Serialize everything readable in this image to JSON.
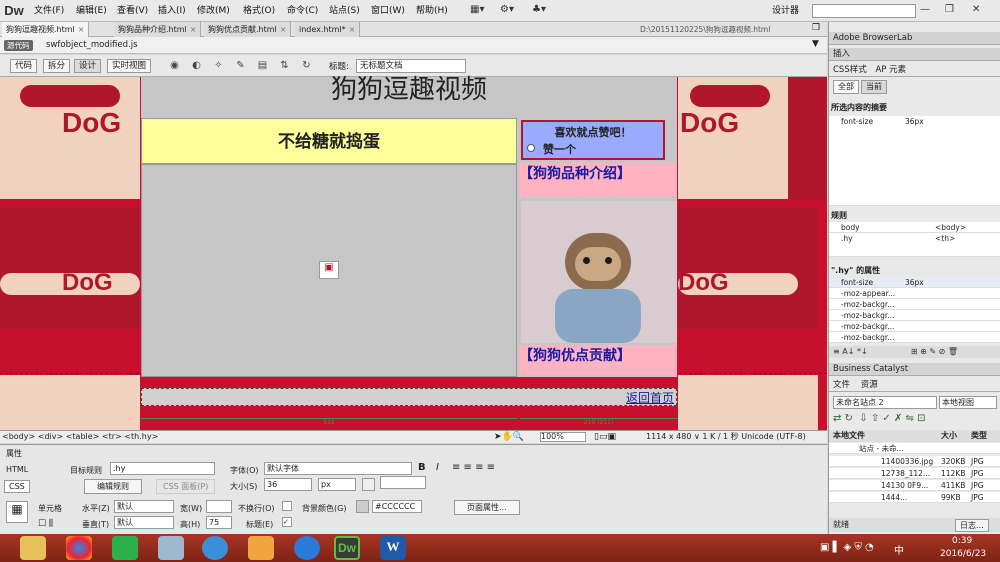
{
  "menubar": {
    "logo": "Dw",
    "items": [
      "文件(F)",
      "编辑(E)",
      "查看(V)",
      "插入(I)",
      "修改(M)",
      "格式(O)",
      "命令(C)",
      "站点(S)",
      "窗口(W)",
      "帮助(H)"
    ],
    "workspace": "设计器",
    "search_placeholder": ""
  },
  "tabs": [
    {
      "label": "狗狗逗趣视频.html",
      "active": true
    },
    {
      "label": "狗狗品种介绍.html",
      "active": false
    },
    {
      "label": "狗狗优点贡献.html",
      "active": false
    },
    {
      "label": "index.html*",
      "active": false
    }
  ],
  "file_path": "D:\\20151120225\\狗狗逗趣视频.html",
  "related_files": {
    "tag": "源代码",
    "file": "swfobject_modified.js"
  },
  "toolbar": {
    "code": "代码",
    "split": "拆分",
    "design": "设计",
    "live": "实时视图",
    "title_label": "标题:",
    "title_value": "无标题文档"
  },
  "page": {
    "heading": "狗狗逗趣视频",
    "banner": "不给糖就捣蛋",
    "like_title": "喜欢就点赞吧！",
    "like_option": "赞一个",
    "link1": "【狗狗品种介绍】",
    "link2": "【狗狗优点贡献】",
    "back": "返回首页",
    "ruler_left": "512",
    "ruler_right": "210 (211)",
    "tile_text": "DoG"
  },
  "statusbar": {
    "tags": "<body> <div> <table> <tr> <th.hy>",
    "zoom": "100%",
    "info": "1114 x 480 ∨ 1 K / 1 秒  Unicode (UTF-8)"
  },
  "properties": {
    "title": "属性",
    "html": "HTML",
    "css": "CSS",
    "target_rule_label": "目标规则",
    "target_rule": ".hy",
    "edit_rule": "编辑规则",
    "css_panel": "CSS 面板(P)",
    "font_label": "字体(O)",
    "font": "默认字体",
    "size_label": "大小(S)",
    "size": "36",
    "unit": "px",
    "cell_label": "单元格",
    "horz_label": "水平(Z)",
    "horz": "默认",
    "vert_label": "垂直(T)",
    "vert": "默认",
    "width_label": "宽(W)",
    "height_label": "高(H)",
    "height": "75",
    "nowrap_label": "不换行(O)",
    "header_label": "标题(E)",
    "bg_label": "背景颜色(G)",
    "bg": "#CCCCCC",
    "page_props": "页面属性..."
  },
  "panels": {
    "browserlab": "Adobe BrowserLab",
    "insert": "插入",
    "css_styles": "CSS样式",
    "ap": "AP 元素",
    "all": "全部",
    "current": "当前",
    "summary_title": "所选内容的摘要",
    "summary": [
      {
        "prop": "font-size",
        "val": "36px"
      }
    ],
    "rules_title": "规则",
    "rules": [
      {
        "sel": "body",
        "tag": "<body>"
      },
      {
        "sel": ".hy",
        "tag": "<th>"
      }
    ],
    "props_title": "\".hy\" 的属性",
    "props": [
      {
        "prop": "font-size",
        "val": "36px"
      },
      {
        "prop": "-moz-appear...",
        "val": ""
      },
      {
        "prop": "-moz-backgr...",
        "val": ""
      },
      {
        "prop": "-moz-backgr...",
        "val": ""
      },
      {
        "prop": "-moz-backgr...",
        "val": ""
      },
      {
        "prop": "-moz-backgr...",
        "val": ""
      }
    ],
    "bc": "Business Catalyst",
    "files": "文件",
    "assets": "资源",
    "site": "未命名站点 2",
    "view": "本地视图",
    "local_files": "本地文件",
    "size_col": "大小",
    "type_col": "类型",
    "site_row": "站点 - 未命...",
    "file_list": [
      {
        "name": "11400336.jpg",
        "size": "320KB",
        "type": "JPG"
      },
      {
        "name": "12738_112...",
        "size": "112KB",
        "type": "JPG"
      },
      {
        "name": "14130 0F9...",
        "size": "411KB",
        "type": "JPG"
      },
      {
        "name": "1444...",
        "size": "99KB",
        "type": "JPG"
      }
    ],
    "ready": "就绪",
    "log": "日志..."
  },
  "taskbar": {
    "time": "0:39",
    "date": "2016/6/23",
    "ime": "中"
  }
}
